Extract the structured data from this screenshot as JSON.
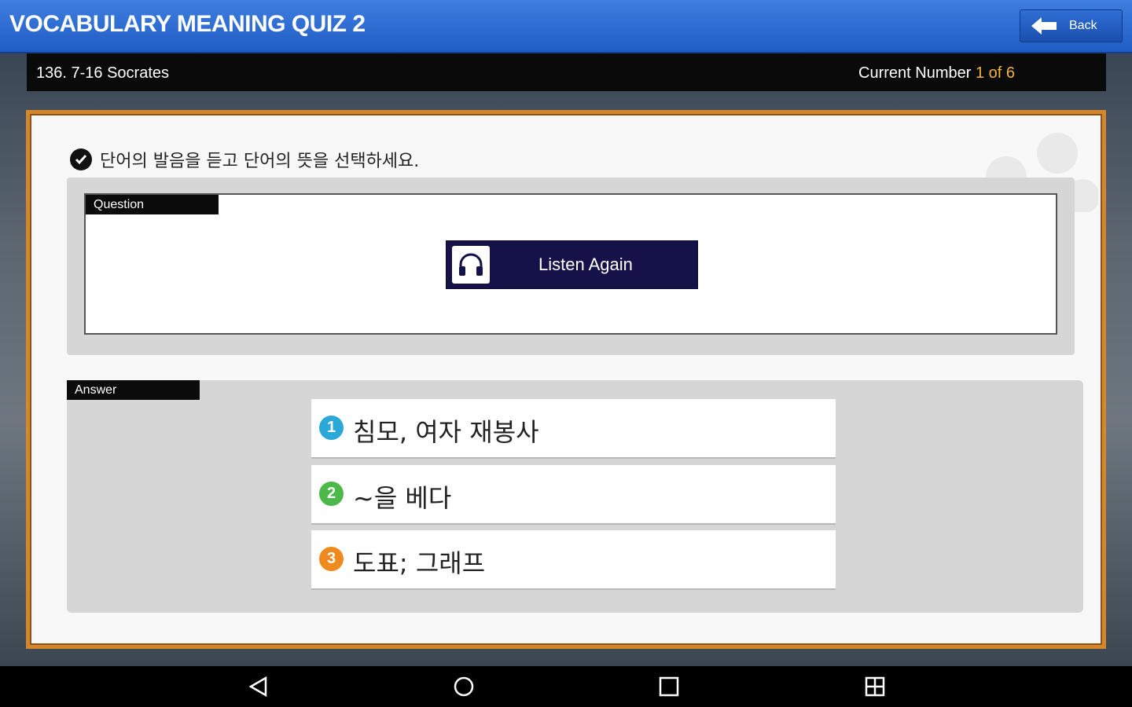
{
  "header": {
    "title": "VOCABULARY MEANING QUIZ 2",
    "back_label": "Back"
  },
  "info": {
    "lesson": "136. 7-16  Socrates",
    "counter_label": "Current Number",
    "current_number": "1 of 6"
  },
  "instruction": "단어의 발음을 듣고 단어의 뜻을 선택하세요.",
  "question": {
    "tag": "Question",
    "listen_label": "Listen Again"
  },
  "answer": {
    "tag": "Answer",
    "options": [
      {
        "number": "1",
        "text": "침모, 여자 재봉사",
        "color": "#2aa8d8"
      },
      {
        "number": "2",
        "text": "~을 베다",
        "color": "#4cb84a"
      },
      {
        "number": "3",
        "text": "도표; 그래프",
        "color": "#f08a1e"
      }
    ]
  },
  "colors": {
    "header_blue": "#1f5cc4",
    "card_border": "#d4862f",
    "listen_button": "#15124a",
    "counter_accent": "#f3b43c"
  },
  "icons": [
    "back-arrow-icon",
    "check-circle-icon",
    "headphones-icon",
    "nav-back-icon",
    "nav-home-icon",
    "nav-recents-icon",
    "nav-screenshot-icon"
  ]
}
